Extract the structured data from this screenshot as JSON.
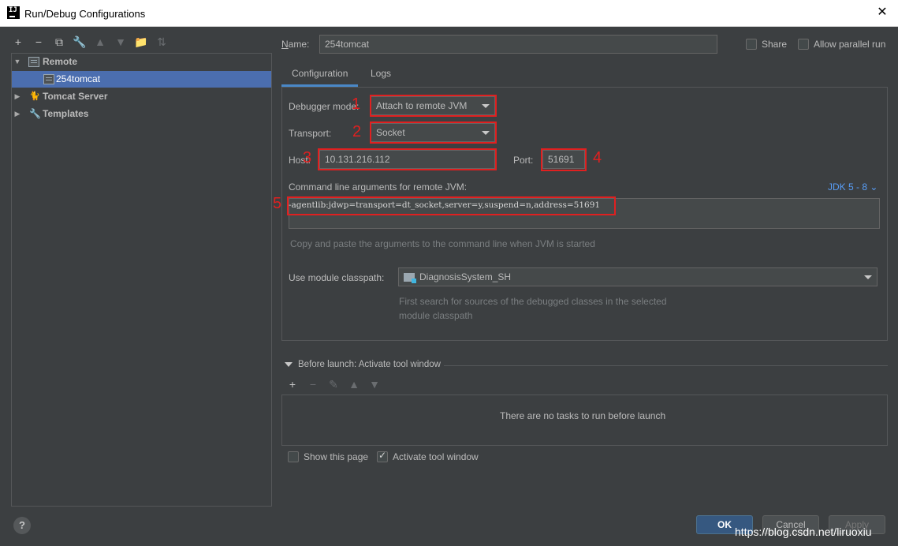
{
  "window": {
    "title": "Run/Debug Configurations",
    "close_glyph": "✕"
  },
  "toolbar": [
    "+",
    "−",
    "⧉",
    "🔧",
    "▲",
    "▼",
    "📁",
    "⇅"
  ],
  "tree": {
    "remote": "Remote",
    "config_254": "254tomcat",
    "tomcat": "Tomcat Server",
    "templates": "Templates"
  },
  "form": {
    "name_label": "Name:",
    "name_value": "254tomcat",
    "share_label": "Share",
    "parallel_label": "Allow parallel run"
  },
  "tabs": {
    "configuration": "Configuration",
    "logs": "Logs"
  },
  "config": {
    "debugger_mode_label": "Debugger mode:",
    "debugger_mode_value": "Attach to remote JVM",
    "transport_label": "Transport:",
    "transport_value": "Socket",
    "host_label": "Host:",
    "host_value": "10.131.216.112",
    "port_label": "Port:",
    "port_value": "51691",
    "cmd_label": "Command line arguments for remote JVM:",
    "jdk_link": "JDK 5 - 8",
    "cmd_value": "-agentlib:jdwp=transport=dt_socket,server=y,suspend=n,address=51691",
    "cmd_hint": "Copy and paste the arguments to the command line when JVM is started",
    "module_label": "Use module classpath:",
    "module_value": "DiagnosisSystem_SH",
    "module_hint_1": "First search for sources of the debugged classes in the selected",
    "module_hint_2": "module classpath"
  },
  "annotations": [
    "1",
    "2",
    "3",
    "4",
    "5"
  ],
  "before_launch": {
    "title": "Before launch: Activate tool window",
    "empty": "There are no tasks to run before launch",
    "show_page": "Show this page",
    "activate_tool": "Activate tool window"
  },
  "buttons": {
    "help": "?",
    "ok": "OK",
    "cancel": "Cancel",
    "apply": "Apply"
  },
  "watermark": "https://blog.csdn.net/liruoxiu",
  "colors": {
    "background": "#3c3f41",
    "selection": "#4b6eaf",
    "accent": "#4a88c7",
    "annotation": "#e02020",
    "link": "#589df6"
  }
}
